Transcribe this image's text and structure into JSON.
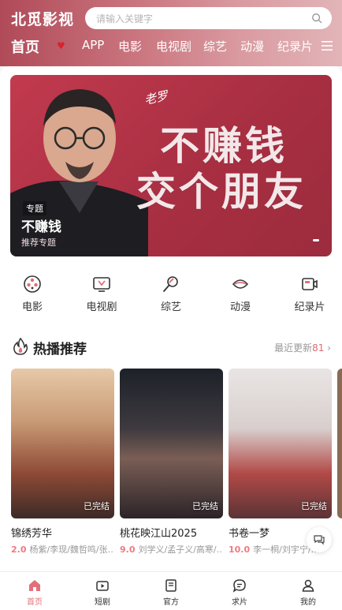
{
  "header": {
    "logo": "北觅影视",
    "search_placeholder": "请输入关键字",
    "nav": [
      "首页",
      "APP",
      "电影",
      "电视剧",
      "综艺",
      "动漫",
      "纪录片"
    ],
    "active_nav": "首页"
  },
  "banner": {
    "signature": "老罗",
    "headline1": "不赚钱",
    "headline2": "交个朋友",
    "tag": "专题",
    "title": "不赚钱",
    "subtitle": "推荐专题"
  },
  "categories": [
    {
      "label": "电影",
      "icon": "film-reel-icon"
    },
    {
      "label": "电视剧",
      "icon": "tv-icon"
    },
    {
      "label": "综艺",
      "icon": "microphone-icon"
    },
    {
      "label": "动漫",
      "icon": "anime-icon"
    },
    {
      "label": "纪录片",
      "icon": "camera-icon"
    }
  ],
  "section": {
    "title": "热播推荐",
    "more_label": "最近更新",
    "more_count": "81"
  },
  "cards": [
    {
      "title": "锦绣芳华",
      "score": "2.0",
      "cast": "杨紫/李现/魏哲鸣/张…",
      "badge": "已完结"
    },
    {
      "title": "桃花映江山2025",
      "score": "9.0",
      "cast": "刘学义/孟子义/高寒/…",
      "badge": "已完结"
    },
    {
      "title": "书卷一梦",
      "score": "10.0",
      "cast": "李一桐/刘宇宁/…",
      "badge": "已完结"
    }
  ],
  "tabbar": [
    {
      "label": "首页",
      "icon": "home-icon",
      "active": true
    },
    {
      "label": "短剧",
      "icon": "play-icon",
      "active": false
    },
    {
      "label": "官方",
      "icon": "document-icon",
      "active": false
    },
    {
      "label": "求片",
      "icon": "chat-icon",
      "active": false
    },
    {
      "label": "我的",
      "icon": "user-icon",
      "active": false
    }
  ],
  "colors": {
    "accent": "#e2707a",
    "header_start": "#b04a58",
    "banner": "#b13447"
  }
}
